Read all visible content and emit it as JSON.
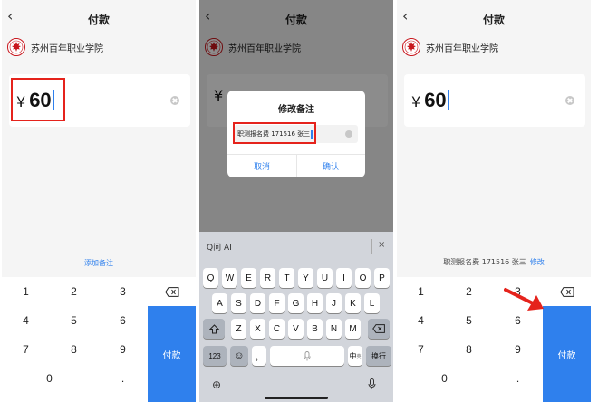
{
  "app": {
    "title": "付款",
    "merchant": "苏州百年职业学院",
    "currency": "¥",
    "amount": "60",
    "add_note": "添加备注",
    "pay": "付款",
    "accent": "#2f80ed",
    "highlight": "#e5231c"
  },
  "keypad": {
    "keys": [
      "1",
      "2",
      "3",
      "4",
      "5",
      "6",
      "7",
      "8",
      "9",
      "0",
      "."
    ]
  },
  "dialog": {
    "title": "修改备注",
    "value": "职测报名费 171516 张三",
    "cancel": "取消",
    "confirm": "确认"
  },
  "keyboard": {
    "suggest": "Q问 AI",
    "close": "×",
    "row1": [
      "Q",
      "W",
      "E",
      "R",
      "T",
      "Y",
      "U",
      "I",
      "O",
      "P"
    ],
    "row2": [
      "A",
      "S",
      "D",
      "F",
      "G",
      "H",
      "J",
      "K",
      "L"
    ],
    "row3": [
      "Z",
      "X",
      "C",
      "V",
      "B",
      "N",
      "M"
    ],
    "num": "123",
    "emoji": "☺",
    "comma": "，",
    "lang": "中",
    "lang_sub": "英",
    "enter": "换行"
  },
  "result": {
    "note": "职测报名费 171516 张三",
    "edit": "修改"
  }
}
